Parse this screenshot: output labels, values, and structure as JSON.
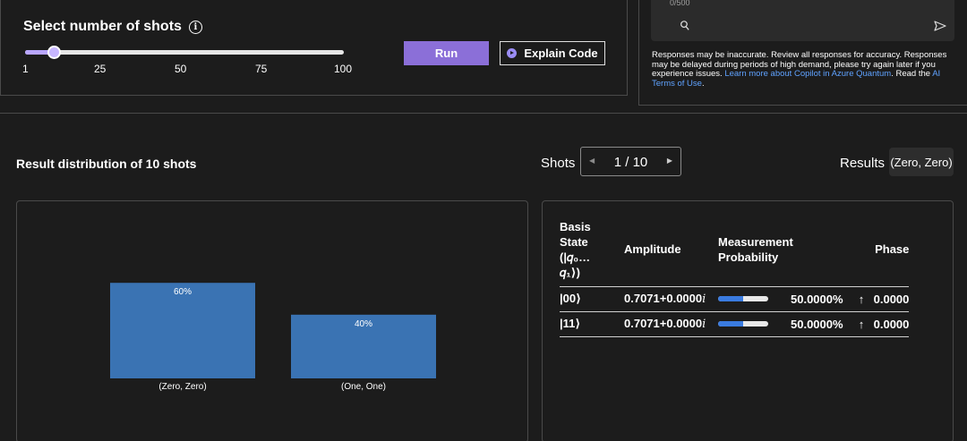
{
  "shots_panel": {
    "title": "Select number of shots",
    "info_icon": "info-icon",
    "slider": {
      "min": 1,
      "max": 100,
      "value": 10,
      "ticks": [
        "1",
        "25",
        "50",
        "75",
        "100"
      ]
    },
    "run_label": "Run",
    "explain_label": "Explain Code"
  },
  "copilot": {
    "char_count": "0/500",
    "disclaimer_text": "Responses may be inaccurate. Review all responses for accuracy. Responses may be delayed during periods of high demand, please try again later if you experience issues.",
    "learn_more_link": "Learn more about Copilot in Azure Quantum",
    "read_the": ". Read the",
    "terms_link": "AI Terms of Use",
    "terms_end": "."
  },
  "results": {
    "title": "Result distribution of 10 shots",
    "shots_label": "Shots",
    "pager_value": "1 / 10",
    "results_label": "Results",
    "results_value": "(Zero, Zero)"
  },
  "chart_data": {
    "type": "bar",
    "categories": [
      "(Zero, Zero)",
      "(One, One)"
    ],
    "values": [
      60,
      40
    ],
    "data_labels": [
      "60%",
      "40%"
    ],
    "ylim": [
      0,
      100
    ],
    "bar_color": "#3a73b3"
  },
  "state_table": {
    "headers": {
      "basis_line1": "Basis",
      "basis_line2": "State",
      "basis_line3": "(|𝑞₀…",
      "basis_line4": "𝑞₁⟩)",
      "amplitude": "Amplitude",
      "measurement_line1": "Measurement",
      "measurement_line2": "Probability",
      "phase": "Phase"
    },
    "rows": [
      {
        "basis": "|00⟩",
        "amp_value": "0.7071+0.0000",
        "amp_i": "i",
        "probability": 0.5,
        "prob_text": "50.0000%",
        "arrow": "↑",
        "phase": "0.0000"
      },
      {
        "basis": "|11⟩",
        "amp_value": "0.7071+0.0000",
        "amp_i": "i",
        "probability": 0.5,
        "prob_text": "50.0000%",
        "arrow": "↑",
        "phase": "0.0000"
      }
    ]
  },
  "colors": {
    "accent": "#8b6fd8",
    "link": "#5fa2ff",
    "bar": "#3a73b3",
    "prob_fill": "#3a7be0"
  }
}
